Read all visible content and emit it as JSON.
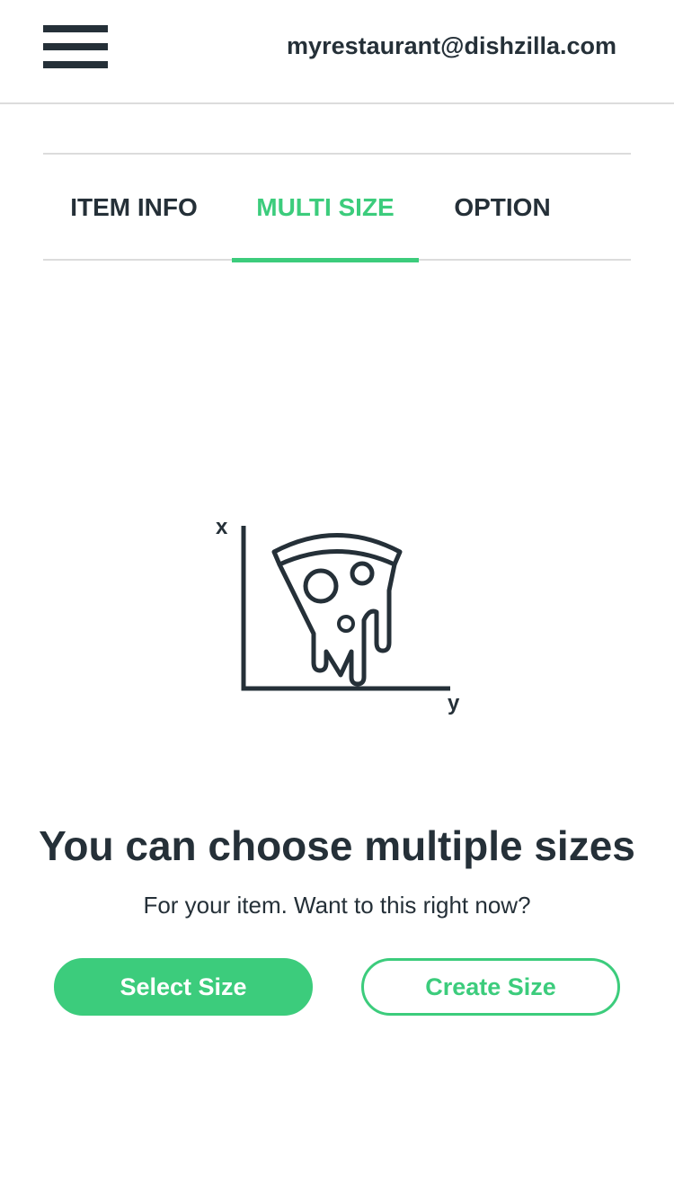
{
  "header": {
    "menu_icon": "hamburger-menu-icon",
    "email": "myrestaurant@dishzilla.com"
  },
  "tabs": [
    {
      "label": "ITEM INFO",
      "active": false
    },
    {
      "label": "MULTI SIZE",
      "active": true
    },
    {
      "label": "OPTION",
      "active": false
    }
  ],
  "illustration": {
    "icon": "pizza-slice-chart-icon",
    "axis_x_label": "x",
    "axis_y_label": "y"
  },
  "empty_state": {
    "title": "You can choose multiple sizes",
    "subtitle": "For your item. Want to this right now?"
  },
  "actions": {
    "select_label": "Select Size",
    "create_label": "Create Size"
  },
  "colors": {
    "accent": "#3ccc7c",
    "text": "#253038",
    "divider": "#dcdcdc"
  }
}
